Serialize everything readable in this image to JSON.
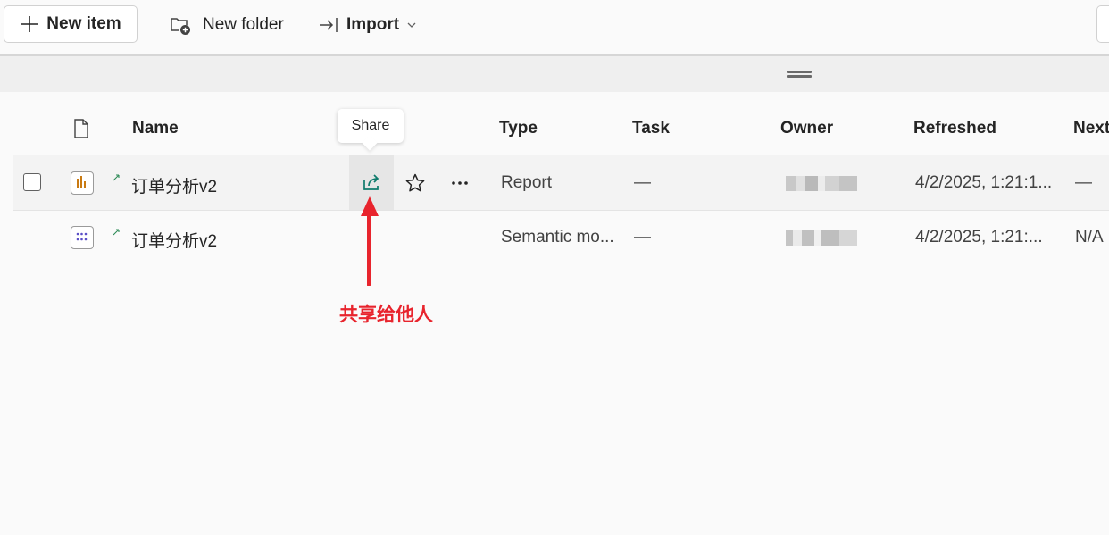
{
  "toolbar": {
    "new_item_label": "New item",
    "new_folder_label": "New folder",
    "import_label": "Import"
  },
  "table": {
    "columns": [
      "Name",
      "Type",
      "Task",
      "Owner",
      "Refreshed",
      "Next"
    ],
    "rows": [
      {
        "name": "订单分析v2",
        "type": "Report",
        "task": "—",
        "refreshed": "4/2/2025, 1:21:1...",
        "next": "—",
        "icon": "report-bar-chart-icon"
      },
      {
        "name": "订单分析v2",
        "type": "Semantic mo...",
        "task": "—",
        "refreshed": "4/2/2025, 1:21:...",
        "next": "N/A",
        "icon": "semantic-model-dots-icon"
      }
    ]
  },
  "tooltip": {
    "text": "Share"
  },
  "annotation": {
    "text": "共享给他人",
    "color": "#e8242d"
  },
  "colors": {
    "accent": "#0f7b6c",
    "report_icon": "#c97a12",
    "semantic_icon": "#5b4fc7",
    "annotation": "#e8242d"
  }
}
